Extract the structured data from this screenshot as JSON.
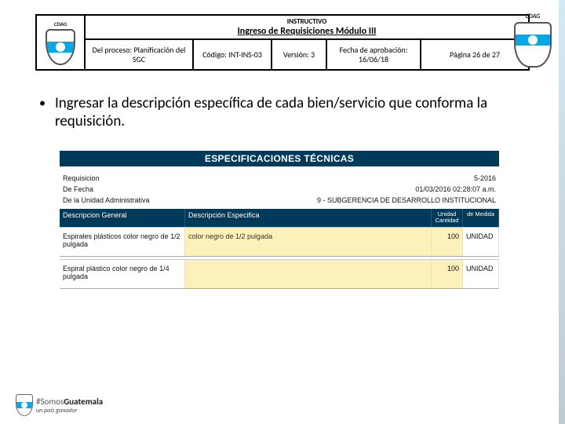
{
  "org": {
    "abbr": "CDAG"
  },
  "header": {
    "supertitle": "INSTRUCTIVO",
    "title": "Ingreso de Requisiciones Módulo III",
    "cells": {
      "proceso": "Del proceso: Planificación del SGC",
      "codigo": "Código: INT-INS-03",
      "version": "Versión: 3",
      "fecha": "Fecha de aprobación: 16/06/18",
      "pagina": "Página 26 de 27"
    }
  },
  "bullet": {
    "text": "Ingresar la descripción específica de cada bien/servicio que conforma la requisición."
  },
  "spec": {
    "banner": "ESPECIFICACIONES TÉCNICAS",
    "meta": {
      "requisicion_label": "Requisicion",
      "requisicion_value": "5-2016",
      "fecha_label": "De Fecha",
      "fecha_value": "01/03/2016 02:28:07 a.m.",
      "unidad_label": "De la Unidad Administrativa",
      "unidad_value": "9 - SUBGERENCIA DE DESARROLLO INSTITUCIONAL"
    },
    "columns": {
      "general": "Descripcion General",
      "especifica": "Descripción Especifica",
      "unidad": "Unidad",
      "cantidad": "Cantidad",
      "medida": "de Medida"
    },
    "rows": [
      {
        "general": "Espirales plásticos color negro de 1/2 pulgada",
        "especifica": "color negro de 1/2 pulgada",
        "cantidad": "100",
        "unidad_medida": "UNIDAD"
      },
      {
        "general": "Espiral plástico color negro de 1/4 pulgada",
        "especifica": "",
        "cantidad": "100",
        "unidad_medida": "UNIDAD"
      }
    ]
  },
  "footer": {
    "hashtag_prefix": "#Somos",
    "hashtag_bold": "Guatemala",
    "tagline": "un país ganador"
  }
}
